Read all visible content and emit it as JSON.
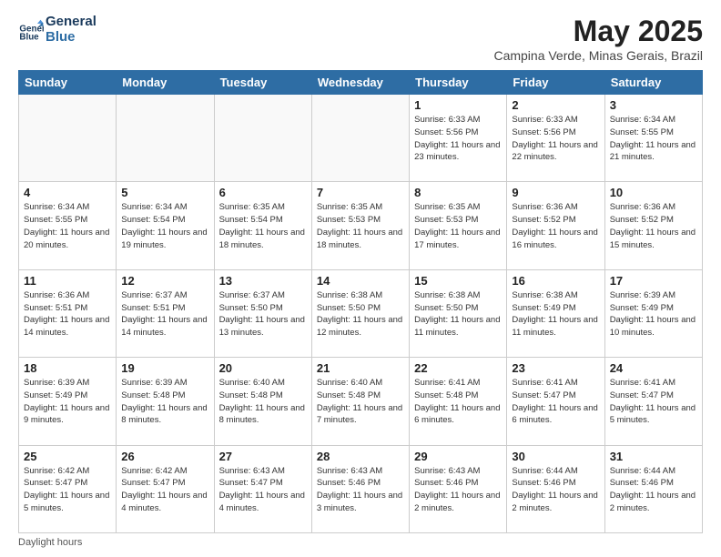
{
  "logo": {
    "line1": "General",
    "line2": "Blue"
  },
  "title": "May 2025",
  "location": "Campina Verde, Minas Gerais, Brazil",
  "days_of_week": [
    "Sunday",
    "Monday",
    "Tuesday",
    "Wednesday",
    "Thursday",
    "Friday",
    "Saturday"
  ],
  "footer": "Daylight hours",
  "weeks": [
    [
      {
        "day": "",
        "info": ""
      },
      {
        "day": "",
        "info": ""
      },
      {
        "day": "",
        "info": ""
      },
      {
        "day": "",
        "info": ""
      },
      {
        "day": "1",
        "info": "Sunrise: 6:33 AM\nSunset: 5:56 PM\nDaylight: 11 hours\nand 23 minutes."
      },
      {
        "day": "2",
        "info": "Sunrise: 6:33 AM\nSunset: 5:56 PM\nDaylight: 11 hours\nand 22 minutes."
      },
      {
        "day": "3",
        "info": "Sunrise: 6:34 AM\nSunset: 5:55 PM\nDaylight: 11 hours\nand 21 minutes."
      }
    ],
    [
      {
        "day": "4",
        "info": "Sunrise: 6:34 AM\nSunset: 5:55 PM\nDaylight: 11 hours\nand 20 minutes."
      },
      {
        "day": "5",
        "info": "Sunrise: 6:34 AM\nSunset: 5:54 PM\nDaylight: 11 hours\nand 19 minutes."
      },
      {
        "day": "6",
        "info": "Sunrise: 6:35 AM\nSunset: 5:54 PM\nDaylight: 11 hours\nand 18 minutes."
      },
      {
        "day": "7",
        "info": "Sunrise: 6:35 AM\nSunset: 5:53 PM\nDaylight: 11 hours\nand 18 minutes."
      },
      {
        "day": "8",
        "info": "Sunrise: 6:35 AM\nSunset: 5:53 PM\nDaylight: 11 hours\nand 17 minutes."
      },
      {
        "day": "9",
        "info": "Sunrise: 6:36 AM\nSunset: 5:52 PM\nDaylight: 11 hours\nand 16 minutes."
      },
      {
        "day": "10",
        "info": "Sunrise: 6:36 AM\nSunset: 5:52 PM\nDaylight: 11 hours\nand 15 minutes."
      }
    ],
    [
      {
        "day": "11",
        "info": "Sunrise: 6:36 AM\nSunset: 5:51 PM\nDaylight: 11 hours\nand 14 minutes."
      },
      {
        "day": "12",
        "info": "Sunrise: 6:37 AM\nSunset: 5:51 PM\nDaylight: 11 hours\nand 14 minutes."
      },
      {
        "day": "13",
        "info": "Sunrise: 6:37 AM\nSunset: 5:50 PM\nDaylight: 11 hours\nand 13 minutes."
      },
      {
        "day": "14",
        "info": "Sunrise: 6:38 AM\nSunset: 5:50 PM\nDaylight: 11 hours\nand 12 minutes."
      },
      {
        "day": "15",
        "info": "Sunrise: 6:38 AM\nSunset: 5:50 PM\nDaylight: 11 hours\nand 11 minutes."
      },
      {
        "day": "16",
        "info": "Sunrise: 6:38 AM\nSunset: 5:49 PM\nDaylight: 11 hours\nand 11 minutes."
      },
      {
        "day": "17",
        "info": "Sunrise: 6:39 AM\nSunset: 5:49 PM\nDaylight: 11 hours\nand 10 minutes."
      }
    ],
    [
      {
        "day": "18",
        "info": "Sunrise: 6:39 AM\nSunset: 5:49 PM\nDaylight: 11 hours\nand 9 minutes."
      },
      {
        "day": "19",
        "info": "Sunrise: 6:39 AM\nSunset: 5:48 PM\nDaylight: 11 hours\nand 8 minutes."
      },
      {
        "day": "20",
        "info": "Sunrise: 6:40 AM\nSunset: 5:48 PM\nDaylight: 11 hours\nand 8 minutes."
      },
      {
        "day": "21",
        "info": "Sunrise: 6:40 AM\nSunset: 5:48 PM\nDaylight: 11 hours\nand 7 minutes."
      },
      {
        "day": "22",
        "info": "Sunrise: 6:41 AM\nSunset: 5:48 PM\nDaylight: 11 hours\nand 6 minutes."
      },
      {
        "day": "23",
        "info": "Sunrise: 6:41 AM\nSunset: 5:47 PM\nDaylight: 11 hours\nand 6 minutes."
      },
      {
        "day": "24",
        "info": "Sunrise: 6:41 AM\nSunset: 5:47 PM\nDaylight: 11 hours\nand 5 minutes."
      }
    ],
    [
      {
        "day": "25",
        "info": "Sunrise: 6:42 AM\nSunset: 5:47 PM\nDaylight: 11 hours\nand 5 minutes."
      },
      {
        "day": "26",
        "info": "Sunrise: 6:42 AM\nSunset: 5:47 PM\nDaylight: 11 hours\nand 4 minutes."
      },
      {
        "day": "27",
        "info": "Sunrise: 6:43 AM\nSunset: 5:47 PM\nDaylight: 11 hours\nand 4 minutes."
      },
      {
        "day": "28",
        "info": "Sunrise: 6:43 AM\nSunset: 5:46 PM\nDaylight: 11 hours\nand 3 minutes."
      },
      {
        "day": "29",
        "info": "Sunrise: 6:43 AM\nSunset: 5:46 PM\nDaylight: 11 hours\nand 2 minutes."
      },
      {
        "day": "30",
        "info": "Sunrise: 6:44 AM\nSunset: 5:46 PM\nDaylight: 11 hours\nand 2 minutes."
      },
      {
        "day": "31",
        "info": "Sunrise: 6:44 AM\nSunset: 5:46 PM\nDaylight: 11 hours\nand 2 minutes."
      }
    ]
  ]
}
